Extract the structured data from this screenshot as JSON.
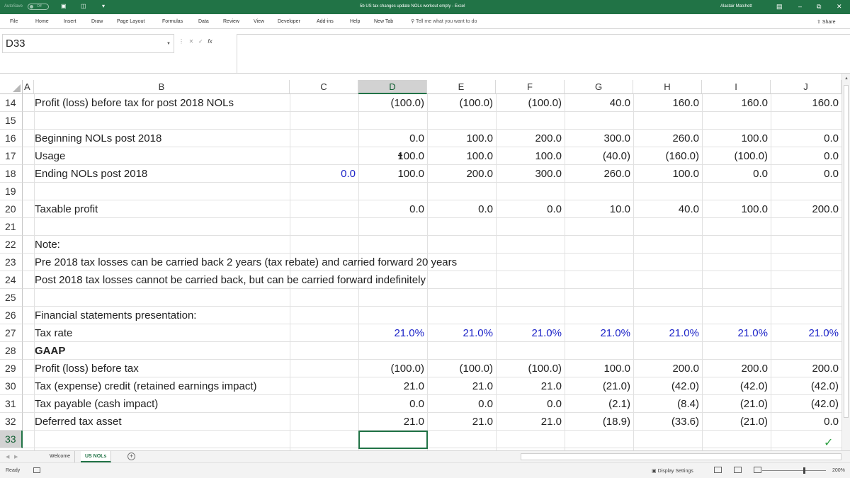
{
  "titlebar": {
    "autosave_label": "AutoSave",
    "autosave_state": "Off",
    "document_title": "5b US tax changes update NOLs workout empty  -  Excel",
    "user_name": "Alastair Matchett",
    "brand_color": "#217346"
  },
  "ribbon": {
    "tabs": [
      "File",
      "Home",
      "Insert",
      "Draw",
      "Page Layout",
      "Formulas",
      "Data",
      "Review",
      "View",
      "Developer",
      "Add-ins",
      "Help",
      "New Tab"
    ],
    "tell_me": "Tell me what you want to do",
    "share": "Share"
  },
  "formula_bar": {
    "name_box": "D33",
    "fx": "fx",
    "value": ""
  },
  "columns": [
    "A",
    "B",
    "C",
    "D",
    "E",
    "F",
    "G",
    "H",
    "I",
    "J"
  ],
  "rows": [
    {
      "num": "14",
      "label": "Profit (loss) before tax for post 2018 NOLs",
      "c": "",
      "vals": [
        "(100.0)",
        "(100.0)",
        "(100.0)",
        "40.0",
        "160.0",
        "160.0",
        "160.0"
      ],
      "blue": false
    },
    {
      "num": "15",
      "label": "",
      "c": "",
      "vals": [
        "",
        "",
        "",
        "",
        "",
        "",
        ""
      ],
      "blue": false
    },
    {
      "num": "16",
      "label": "Beginning NOLs post 2018",
      "c": "",
      "vals": [
        "0.0",
        "100.0",
        "200.0",
        "300.0",
        "260.0",
        "100.0",
        "0.0"
      ],
      "blue": false
    },
    {
      "num": "17",
      "label": "Usage",
      "c": "",
      "vals": [
        "100.0",
        "100.0",
        "100.0",
        "(40.0)",
        "(160.0)",
        "(100.0)",
        "0.0"
      ],
      "blue": false
    },
    {
      "num": "18",
      "label": "Ending NOLs post 2018",
      "c": "0.0",
      "vals": [
        "100.0",
        "200.0",
        "300.0",
        "260.0",
        "100.0",
        "0.0",
        "0.0"
      ],
      "blue": false
    },
    {
      "num": "19",
      "label": "",
      "c": "",
      "vals": [
        "",
        "",
        "",
        "",
        "",
        "",
        ""
      ],
      "blue": false
    },
    {
      "num": "20",
      "label": "Taxable profit",
      "c": "",
      "vals": [
        "0.0",
        "0.0",
        "0.0",
        "10.0",
        "40.0",
        "100.0",
        "200.0"
      ],
      "blue": false
    },
    {
      "num": "21",
      "label": "",
      "c": "",
      "vals": [
        "",
        "",
        "",
        "",
        "",
        "",
        ""
      ],
      "blue": false
    },
    {
      "num": "22",
      "label": "Note:",
      "c": "",
      "vals": [
        "",
        "",
        "",
        "",
        "",
        "",
        ""
      ],
      "blue": false
    },
    {
      "num": "23",
      "label": "Pre 2018 tax losses can be carried back 2 years (tax rebate) and carried forward 20 years",
      "c": "",
      "vals": [
        "",
        "",
        "",
        "",
        "",
        "",
        ""
      ],
      "blue": false
    },
    {
      "num": "24",
      "label": "Post 2018 tax losses cannot be carried back, but can be carried forward indefinitely",
      "c": "",
      "vals": [
        "",
        "",
        "",
        "",
        "",
        "",
        ""
      ],
      "blue": false
    },
    {
      "num": "25",
      "label": "",
      "c": "",
      "vals": [
        "",
        "",
        "",
        "",
        "",
        "",
        ""
      ],
      "blue": false
    },
    {
      "num": "26",
      "label": "Financial statements presentation:",
      "c": "",
      "vals": [
        "",
        "",
        "",
        "",
        "",
        "",
        ""
      ],
      "blue": false
    },
    {
      "num": "27",
      "label": "Tax rate",
      "c": "",
      "vals": [
        "21.0%",
        "21.0%",
        "21.0%",
        "21.0%",
        "21.0%",
        "21.0%",
        "21.0%"
      ],
      "blue": true
    },
    {
      "num": "28",
      "label": "GAAP",
      "c": "",
      "vals": [
        "",
        "",
        "",
        "",
        "",
        "",
        ""
      ],
      "blue": false,
      "bold": true
    },
    {
      "num": "29",
      "label": "Profit (loss) before tax",
      "c": "",
      "vals": [
        "(100.0)",
        "(100.0)",
        "(100.0)",
        "100.0",
        "200.0",
        "200.0",
        "200.0"
      ],
      "blue": false
    },
    {
      "num": "30",
      "label": "Tax (expense) credit (retained earnings impact)",
      "c": "",
      "vals": [
        "21.0",
        "21.0",
        "21.0",
        "(21.0)",
        "(42.0)",
        "(42.0)",
        "(42.0)"
      ],
      "blue": false
    },
    {
      "num": "31",
      "label": "Tax payable (cash impact)",
      "c": "",
      "vals": [
        "0.0",
        "0.0",
        "0.0",
        "(2.1)",
        "(8.4)",
        "(21.0)",
        "(42.0)"
      ],
      "blue": false
    },
    {
      "num": "32",
      "label": "Deferred tax asset",
      "c": "",
      "vals": [
        "21.0",
        "21.0",
        "21.0",
        "(18.9)",
        "(33.6)",
        "(21.0)",
        "0.0"
      ],
      "blue": false
    },
    {
      "num": "33",
      "label": "",
      "c": "",
      "vals": [
        "",
        "",
        "",
        "",
        "",
        "",
        ""
      ],
      "blue": false,
      "selected": true
    }
  ],
  "sheets": {
    "tabs": [
      "Welcome",
      "US NOLs"
    ],
    "active": "US NOLs"
  },
  "status": {
    "ready": "Ready",
    "display_settings": "Display Settings",
    "zoom": "200%"
  },
  "colors": {
    "input_blue": "#1d24c8",
    "selection_green": "#217346"
  }
}
